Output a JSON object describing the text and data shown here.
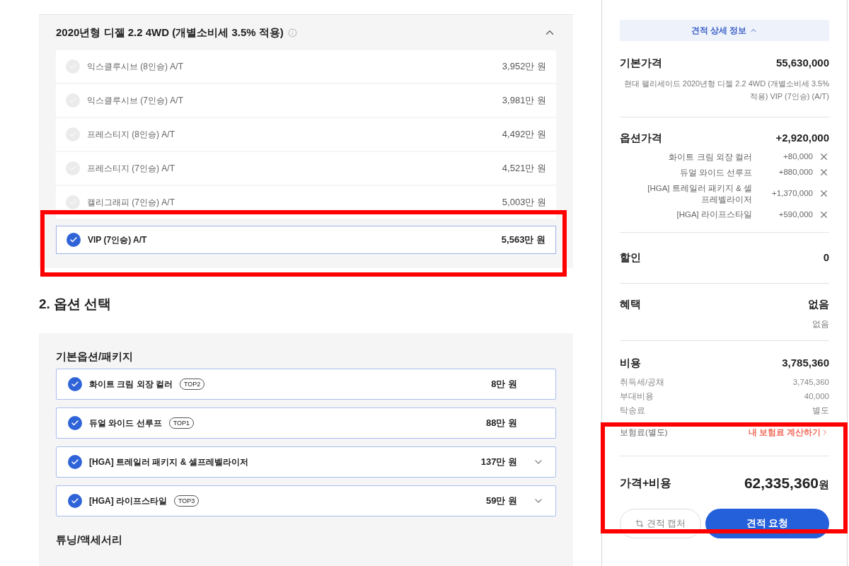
{
  "trim_group": {
    "title": "2020년형 디젤 2.2 4WD (개별소비세 3.5% 적용)",
    "expanded": true,
    "trims": [
      {
        "name": "익스클루시브",
        "seats": "(8인승)",
        "trans": "A/T",
        "price": "3,952만 원",
        "selected": false
      },
      {
        "name": "익스클루시브",
        "seats": "(7인승)",
        "trans": "A/T",
        "price": "3,981만 원",
        "selected": false
      },
      {
        "name": "프레스티지",
        "seats": "(8인승)",
        "trans": "A/T",
        "price": "4,492만 원",
        "selected": false
      },
      {
        "name": "프레스티지",
        "seats": "(7인승)",
        "trans": "A/T",
        "price": "4,521만 원",
        "selected": false
      },
      {
        "name": "캘리그래피",
        "seats": "(7인승)",
        "trans": "A/T",
        "price": "5,003만 원",
        "selected": false
      },
      {
        "name": "VIP",
        "seats": "(7인승)",
        "trans": "A/T",
        "price": "5,563만 원",
        "selected": true
      }
    ]
  },
  "option_section": {
    "title": "2. 옵션 선택",
    "groups": [
      {
        "title": "기본옵션/패키지",
        "options": [
          {
            "name": "화이트 크림 외장 컬러",
            "badge": "TOP2",
            "price": "8만 원",
            "checked": true,
            "expandable": false
          },
          {
            "name": "듀얼 와이드 선루프",
            "badge": "TOP1",
            "price": "88만 원",
            "checked": true,
            "expandable": false
          },
          {
            "name": "[HGA] 트레일러 패키지 & 셀프레벨라이저",
            "price": "137만 원",
            "checked": true,
            "expandable": true
          },
          {
            "name": "[HGA] 라이프스타일",
            "badge": "TOP3",
            "price": "59만 원",
            "checked": true,
            "expandable": true
          }
        ]
      },
      {
        "title": "튜닝/액세서리"
      }
    ]
  },
  "summary": {
    "toggle": "견적 상세 정보",
    "base": {
      "label": "기본가격",
      "value": "55,630,000",
      "desc": "현대 팰리세이드 2020년형 디젤 2.2 4WD (개별소비세 3.5% 적용) VIP (7인승) (A/T)"
    },
    "options": {
      "label": "옵션가격",
      "value": "+2,920,000",
      "items": [
        {
          "name": "화이트 크림 외장 컬러",
          "price": "+80,000"
        },
        {
          "name": "듀얼 와이드 선루프",
          "price": "+880,000"
        },
        {
          "name": "[HGA] 트레일러 패키지 & 셀프레벨라이저",
          "price": "+1,370,000"
        },
        {
          "name": "[HGA] 라이프스타일",
          "price": "+590,000"
        }
      ]
    },
    "discount": {
      "label": "할인",
      "value": "0"
    },
    "benefit": {
      "label": "혜택",
      "value": "없음",
      "detail": "없음"
    },
    "cost": {
      "label": "비용",
      "value": "3,785,360",
      "items": [
        {
          "label": "취득세/공채",
          "value": "3,745,360"
        },
        {
          "label": "부대비용",
          "value": "40,000"
        },
        {
          "label": "탁송료",
          "value": "별도"
        }
      ]
    },
    "insurance": {
      "label": "보험료(별도)",
      "link": "내 보험료 계산하기"
    },
    "total": {
      "label": "가격+비용",
      "value": "62,335,360",
      "unit": "원"
    },
    "buttons": {
      "capture": "견적 캡처",
      "request": "견적 요청"
    }
  }
}
